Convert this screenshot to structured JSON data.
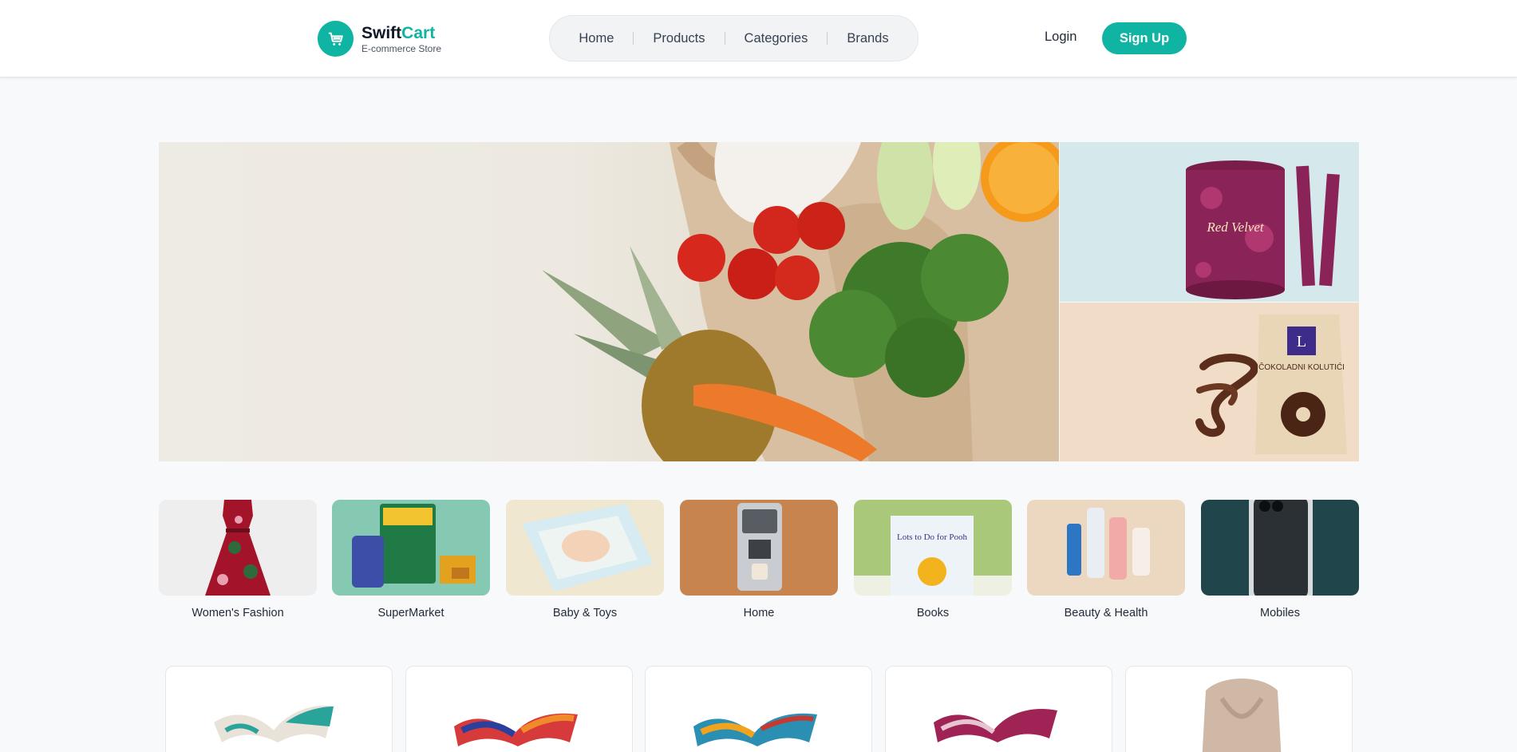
{
  "header": {
    "brand_main": "Swift",
    "brand_accent": "Cart",
    "tagline": "E-commerce Store",
    "nav": [
      "Home",
      "Products",
      "Categories",
      "Brands"
    ],
    "login_label": "Login",
    "signup_label": "Sign Up"
  },
  "theme": {
    "accent": "#0fb5a2",
    "background": "#f8f9fa"
  },
  "categories": [
    {
      "label": "Women's Fashion"
    },
    {
      "label": "SuperMarket"
    },
    {
      "label": "Baby & Toys"
    },
    {
      "label": "Home"
    },
    {
      "label": "Books"
    },
    {
      "label": "Beauty & Health"
    },
    {
      "label": "Mobiles"
    }
  ],
  "promo": {
    "wafer_brand": "Red Velvet",
    "choco_title": "ČOKOLADNI KOLUTIĆI",
    "book_title": "Lots to Do for Pooh"
  }
}
